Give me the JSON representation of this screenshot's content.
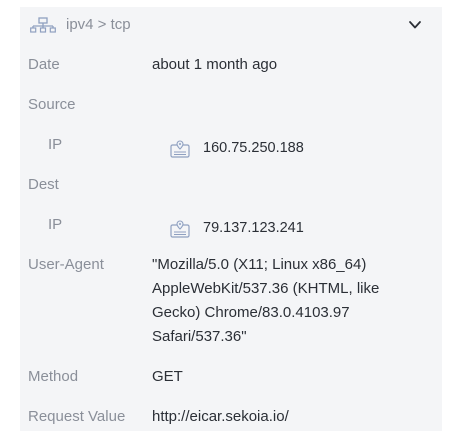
{
  "header": {
    "title": "ipv4 > tcp",
    "network_icon": "network-icon",
    "toggle_icon": "chevron-down-icon"
  },
  "fields": {
    "date": {
      "label": "Date",
      "value": "about 1 month ago"
    },
    "source": {
      "label": "Source",
      "ip": {
        "label": "IP",
        "value": "160.75.250.188",
        "icon": "location-pin-icon"
      }
    },
    "dest": {
      "label": "Dest",
      "ip": {
        "label": "IP",
        "value": "79.137.123.241",
        "icon": "location-pin-icon"
      }
    },
    "user_agent": {
      "label": "User-Agent",
      "value": "\"Mozilla/5.0 (X11; Linux x86_64) AppleWebKit/537.36 (KHTML, like Gecko) Chrome/83.0.4103.97 Safari/537.36\""
    },
    "method": {
      "label": "Method",
      "value": "GET"
    },
    "request_value": {
      "label": "Request Value",
      "value": "http://eicar.sekoia.io/"
    }
  },
  "colors": {
    "panel_bg": "#f4f5f7",
    "label": "#8a8f99",
    "value": "#2b2f36",
    "icon": "#8fa0c0"
  }
}
